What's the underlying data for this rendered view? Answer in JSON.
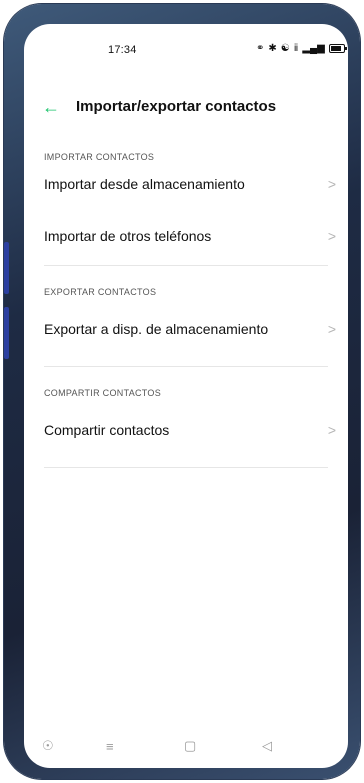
{
  "status_bar": {
    "time": "17:34",
    "icons": [
      "alarm-icon",
      "bluetooth-icon",
      "wifi-icon",
      "volte-icon",
      "signal-icon",
      "battery-icon"
    ]
  },
  "header": {
    "back_icon": "arrow-left-icon",
    "title": "Importar/exportar contactos",
    "accent_color": "#1bc36b"
  },
  "sections": [
    {
      "label": "IMPORTAR CONTACTOS",
      "items": [
        {
          "label": "Importar desde almacenamiento"
        },
        {
          "label": "Importar de otros teléfonos"
        }
      ]
    },
    {
      "label": "EXPORTAR CONTACTOS",
      "items": [
        {
          "label": "Exportar a disp. de almacenamiento"
        }
      ]
    },
    {
      "label": "COMPARTIR CONTACTOS",
      "items": [
        {
          "label": "Compartir contactos"
        }
      ]
    }
  ],
  "nav_bar": {
    "icons": [
      "accessibility-icon",
      "menu-icon",
      "home-icon",
      "back-icon"
    ]
  }
}
